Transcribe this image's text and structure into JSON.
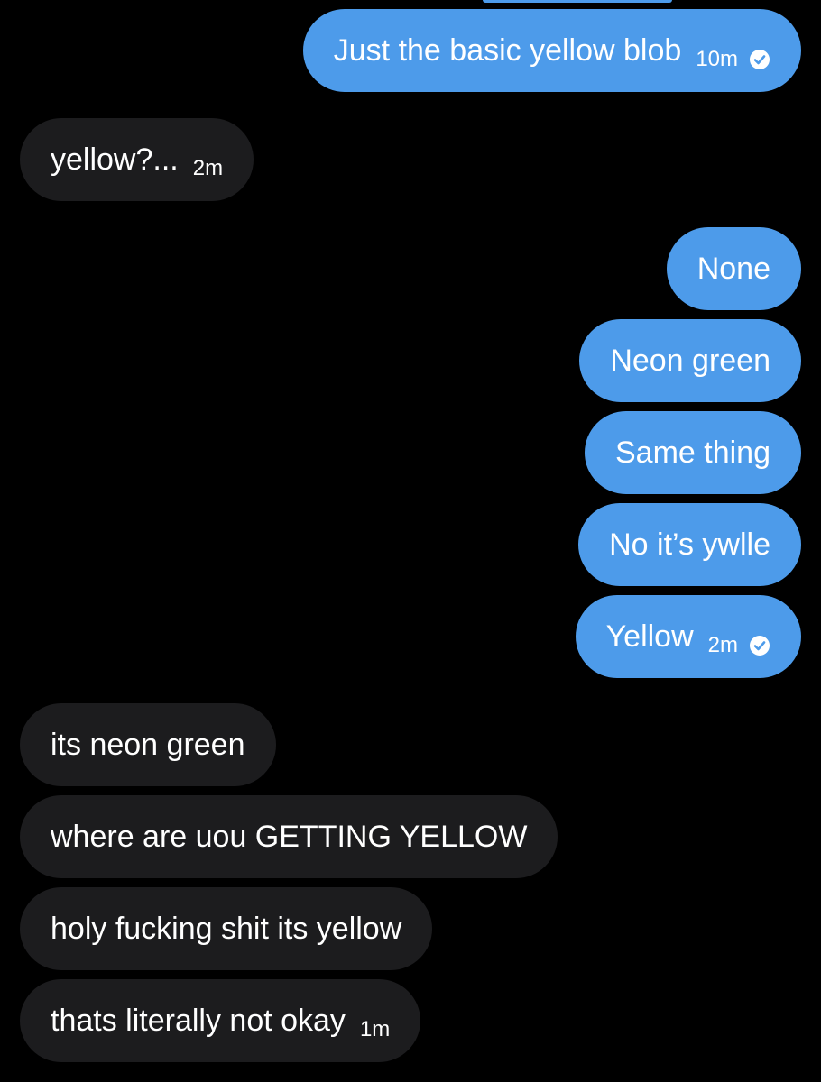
{
  "colors": {
    "background": "#000000",
    "sent_bubble": "#4d9bea",
    "received_bubble": "#1c1c1e",
    "text": "#ffffff"
  },
  "messages": [
    {
      "direction": "sent",
      "text": "Just the basic yellow blob",
      "time": "10m",
      "status_icon": "read-check-icon"
    },
    {
      "direction": "received",
      "text": "yellow?...",
      "time": "2m"
    },
    {
      "direction": "sent",
      "text": "None"
    },
    {
      "direction": "sent",
      "text": "Neon green"
    },
    {
      "direction": "sent",
      "text": "Same thing"
    },
    {
      "direction": "sent",
      "text": "No it’s ywlle"
    },
    {
      "direction": "sent",
      "text": "Yellow",
      "time": "2m",
      "status_icon": "read-check-icon"
    },
    {
      "direction": "received",
      "text": "its neon green"
    },
    {
      "direction": "received",
      "text": "where are uou GETTING YELLOW"
    },
    {
      "direction": "received",
      "text": "holy fucking shit its yellow"
    },
    {
      "direction": "received",
      "text": "thats literally not okay",
      "time": "1m"
    }
  ]
}
